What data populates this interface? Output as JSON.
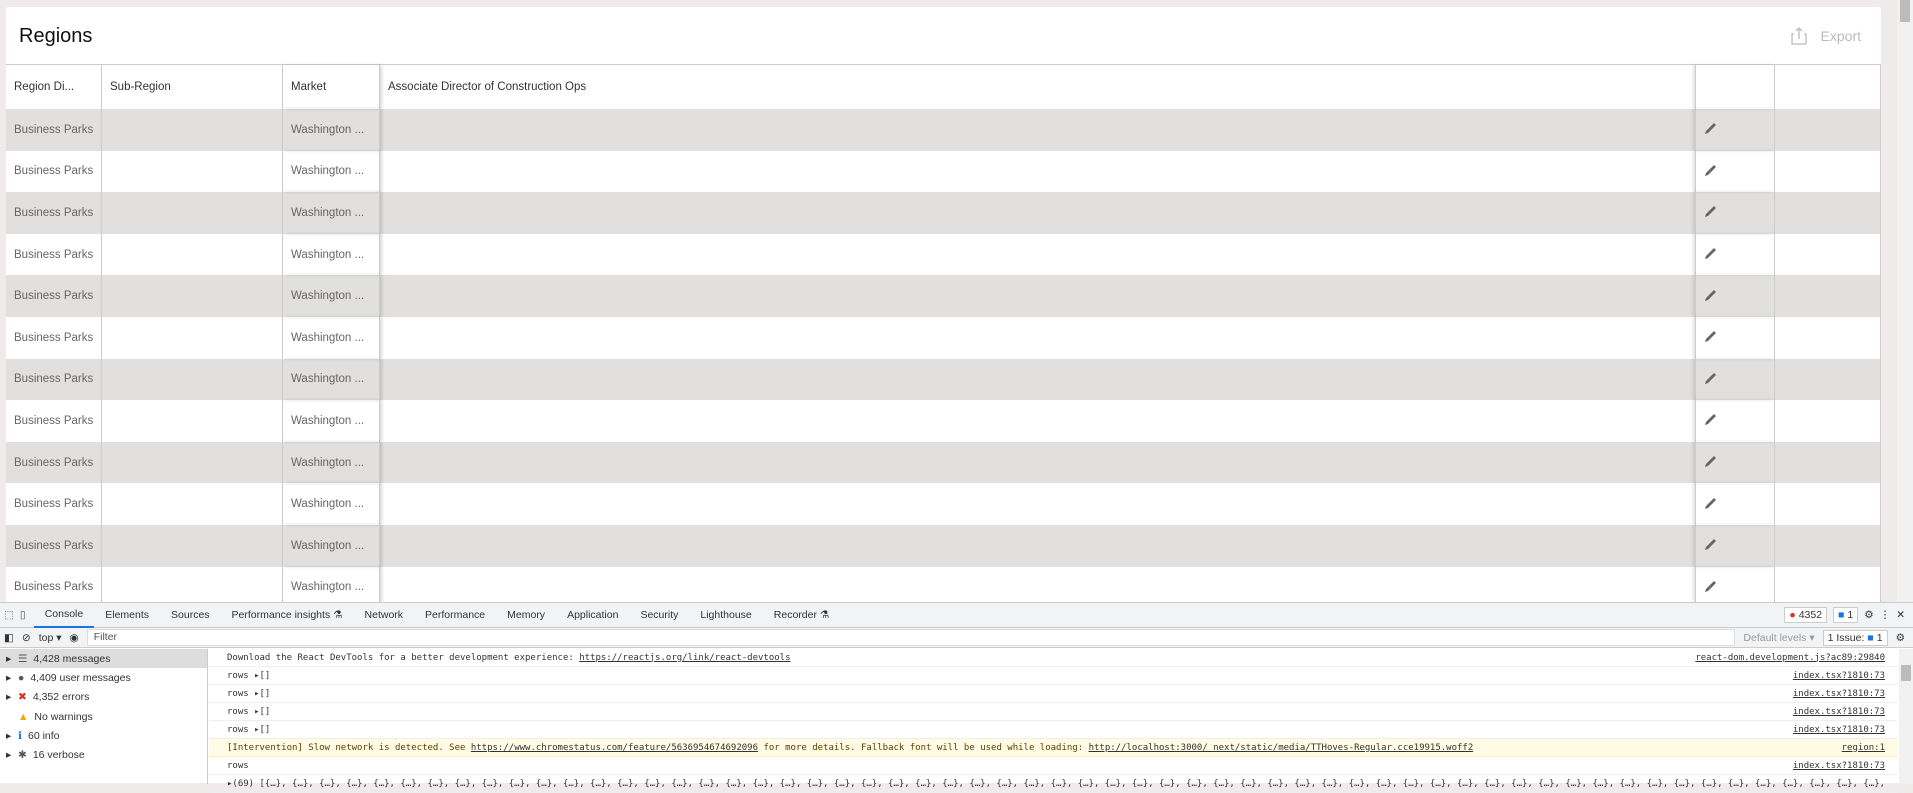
{
  "page": {
    "title": "Regions",
    "export_label": "Export"
  },
  "table": {
    "headers": [
      "Region Di...",
      "Sub-Region",
      "Market",
      "Associate Director of Construction Ops",
      "",
      ""
    ],
    "rows": [
      {
        "region": "Business Parks",
        "sub_region": "",
        "market": "Washington ...",
        "director": ""
      },
      {
        "region": "Business Parks",
        "sub_region": "",
        "market": "Washington ...",
        "director": ""
      },
      {
        "region": "Business Parks",
        "sub_region": "",
        "market": "Washington ...",
        "director": ""
      },
      {
        "region": "Business Parks",
        "sub_region": "",
        "market": "Washington ...",
        "director": ""
      },
      {
        "region": "Business Parks",
        "sub_region": "",
        "market": "Washington ...",
        "director": ""
      },
      {
        "region": "Business Parks",
        "sub_region": "",
        "market": "Washington ...",
        "director": ""
      },
      {
        "region": "Business Parks",
        "sub_region": "",
        "market": "Washington ...",
        "director": ""
      },
      {
        "region": "Business Parks",
        "sub_region": "",
        "market": "Washington ...",
        "director": ""
      },
      {
        "region": "Business Parks",
        "sub_region": "",
        "market": "Washington ...",
        "director": ""
      },
      {
        "region": "Business Parks",
        "sub_region": "",
        "market": "Washington ...",
        "director": ""
      },
      {
        "region": "Business Parks",
        "sub_region": "",
        "market": "Washington ...",
        "director": ""
      },
      {
        "region": "Business Parks",
        "sub_region": "",
        "market": "Washington ...",
        "director": ""
      }
    ]
  },
  "devtools": {
    "tabs": [
      "Console",
      "Elements",
      "Sources",
      "Performance insights ⚗",
      "Network",
      "Performance",
      "Memory",
      "Application",
      "Security",
      "Lighthouse",
      "Recorder ⚗"
    ],
    "error_count": "4352",
    "issue_count": "1",
    "context": "top ▾",
    "filter_placeholder": "Filter",
    "levels": "Default levels ▾",
    "issues_label": "1 Issue:",
    "sidebar": [
      "4,428 messages",
      "4,409 user messages",
      "4,352 errors",
      "No warnings",
      "60 info",
      "16 verbose"
    ],
    "logs": [
      {
        "text": "Download the React DevTools for a better development experience: ",
        "link": "https://reactjs.org/link/react-devtools",
        "source": "react-dom.development.js?ac89:29840"
      },
      {
        "text": "rows ▸[]",
        "source": "index.tsx?1810:73"
      },
      {
        "text": "rows ▸[]",
        "source": "index.tsx?1810:73"
      },
      {
        "text": "rows ▸[]",
        "source": "index.tsx?1810:73"
      },
      {
        "text": "rows ▸[]",
        "source": "index.tsx?1810:73"
      },
      {
        "text": "[Intervention] Slow network is detected. See ",
        "link": "https://www.chromestatus.com/feature/5636954674692096",
        "text2": " for more details. Fallback font will be used while loading: ",
        "link2": "http://localhost:3000/_next/static/media/TTHoves-Regular.cce19915.woff2",
        "source": "region:1",
        "warn": true
      },
      {
        "text": "rows",
        "source": "index.tsx?1810:73"
      },
      {
        "text": "▸(69) [{…}, {…}, {…}, {…}, {…}, {…}, {…}, {…}, {…}, {…}, {…}, {…}, {…}, {…}, {…}, {…}, {…}, {…}, {…}, {…}, {…}, {…}, {…}, {…}, {…}, {…}, {…}, {…}, {…}, {…}, {…}, {…}, {…}, {…}, {…}, {…}, {…}, {…}, {…}, {…}, {…}, {…}, {…}, {…}, {…}, {…}, {…}, {…}, {…}, {…}, {…}, {…}, {…}, {…}, {…}, {…}, {…}, {…}, {…}, {…}, {…}, {…}",
        "source": ""
      }
    ]
  }
}
